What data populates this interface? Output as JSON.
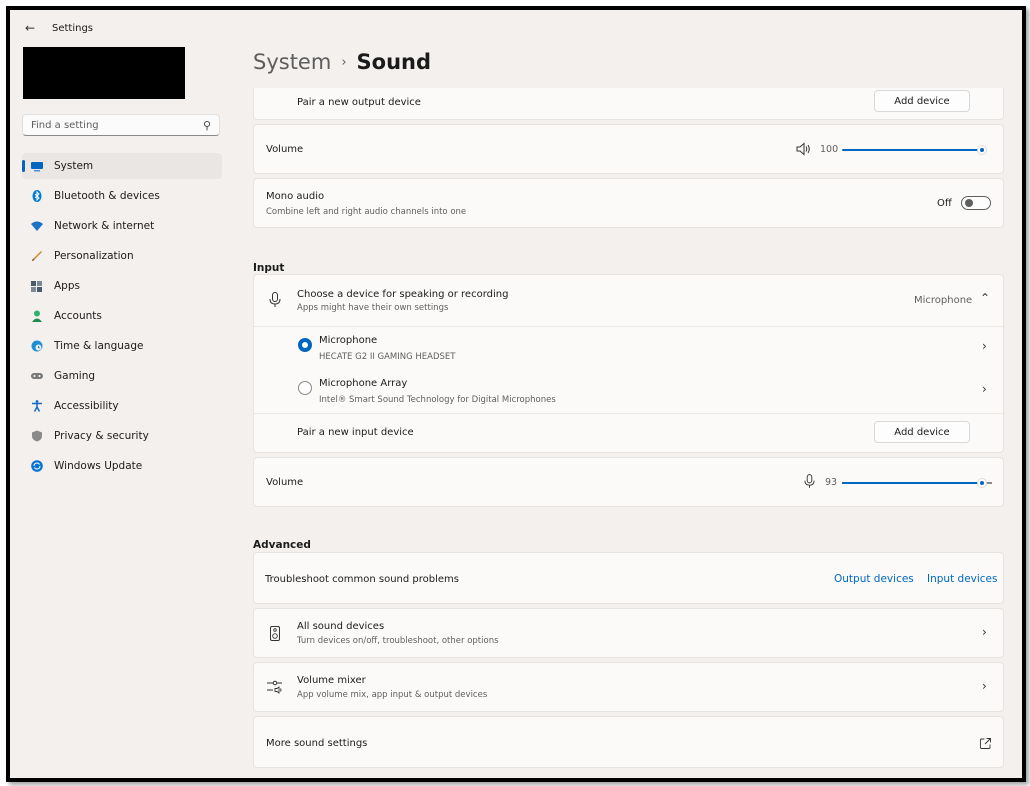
{
  "window": {
    "title": "Settings"
  },
  "search": {
    "placeholder": "Find a setting"
  },
  "sidebar": {
    "items": [
      {
        "label": "System",
        "icon": "system-icon",
        "color": "#0067c0"
      },
      {
        "label": "Bluetooth & devices",
        "icon": "bluetooth-icon",
        "color": "#0078d4"
      },
      {
        "label": "Network & internet",
        "icon": "wifi-icon",
        "color": "#1a73c7"
      },
      {
        "label": "Personalization",
        "icon": "brush-icon",
        "color": "#d9822b"
      },
      {
        "label": "Apps",
        "icon": "apps-icon",
        "color": "#4a5b6b"
      },
      {
        "label": "Accounts",
        "icon": "accounts-icon",
        "color": "#2db36b"
      },
      {
        "label": "Time & language",
        "icon": "globe-clock-icon",
        "color": "#1e90d0"
      },
      {
        "label": "Gaming",
        "icon": "gamepad-icon",
        "color": "#7a7a7a"
      },
      {
        "label": "Accessibility",
        "icon": "accessibility-icon",
        "color": "#1569c7"
      },
      {
        "label": "Privacy & security",
        "icon": "shield-icon",
        "color": "#8a8a8a"
      },
      {
        "label": "Windows Update",
        "icon": "update-icon",
        "color": "#0a74d1"
      }
    ]
  },
  "header": {
    "crumb": "System",
    "separator": "›",
    "current": "Sound"
  },
  "output": {
    "pair_label": "Pair a new output device",
    "add_device": "Add device",
    "volume_label": "Volume",
    "volume_value": "100",
    "volume_fraction": 1.0,
    "mono_title": "Mono audio",
    "mono_sub": "Combine left and right audio channels into one",
    "mono_state": "Off"
  },
  "input": {
    "section": "Input",
    "choose_title": "Choose a device for speaking or recording",
    "choose_sub": "Apps might have their own settings",
    "choose_value": "Microphone",
    "devices": [
      {
        "name": "Microphone",
        "detail": "HECATE G2 II GAMING HEADSET",
        "selected": true
      },
      {
        "name": "Microphone Array",
        "detail": "Intel® Smart Sound Technology for Digital Microphones",
        "selected": false
      }
    ],
    "pair_label": "Pair a new input device",
    "add_device": "Add device",
    "volume_label": "Volume",
    "volume_value": "93",
    "volume_fraction": 0.93
  },
  "advanced": {
    "section": "Advanced",
    "troubleshoot": "Troubleshoot common sound problems",
    "output_devices": "Output devices",
    "input_devices": "Input devices",
    "all_title": "All sound devices",
    "all_sub": "Turn devices on/off, troubleshoot, other options",
    "mixer_title": "Volume mixer",
    "mixer_sub": "App volume mix, app input & output devices",
    "more": "More sound settings"
  },
  "colors": {
    "accent": "#0067c0",
    "background": "#f3f0ee",
    "card": "#fbfaf9"
  }
}
